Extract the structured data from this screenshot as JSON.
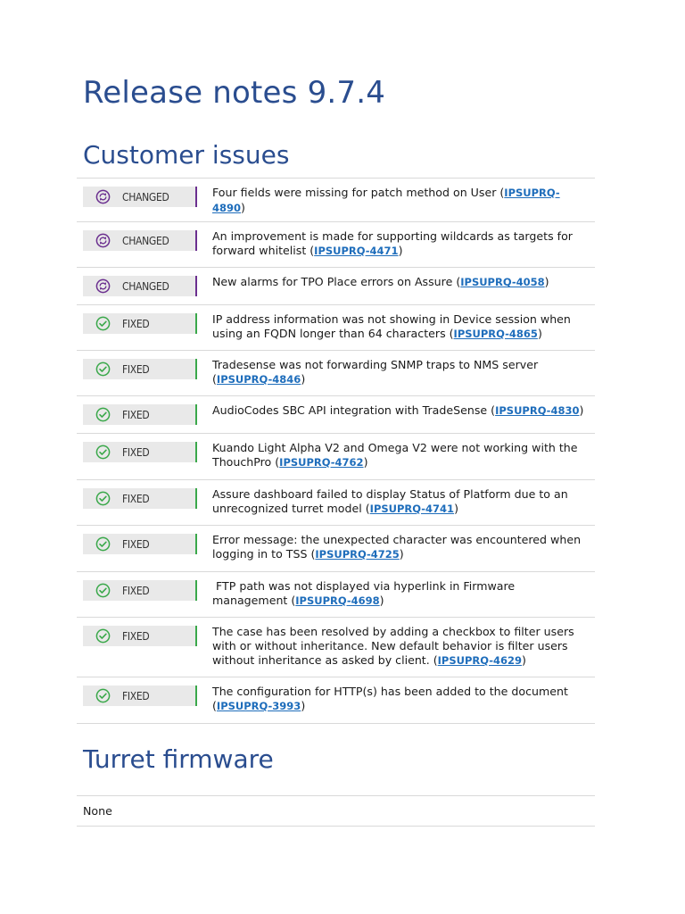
{
  "title": "Release notes 9.7.4",
  "sections": {
    "customer_issues": "Customer issues",
    "turret_firmware": "Turret firmware"
  },
  "colors": {
    "heading": "#2a4d8f",
    "changed": "#6b2f8f",
    "fixed": "#3aa84a",
    "link": "#1e6dbb"
  },
  "issues": [
    {
      "type": "changed",
      "label": "CHANGED",
      "icon": "changed-cycle-icon",
      "text": "Four fields were missing for patch method on User (",
      "ticket": "IPSUPRQ-4890",
      "suffix": ")"
    },
    {
      "type": "changed",
      "label": "CHANGED",
      "icon": "changed-cycle-icon",
      "text": "An improvement is made for supporting wildcards as targets for forward whitelist (",
      "ticket": "IPSUPRQ-4471",
      "suffix": ")"
    },
    {
      "type": "changed",
      "label": "CHANGED",
      "icon": "changed-cycle-icon",
      "text": "New alarms for TPO Place errors on Assure (",
      "ticket": "IPSUPRQ-4058",
      "suffix": ")"
    },
    {
      "type": "fixed",
      "label": "FIXED",
      "icon": "check-circle-icon",
      "text": "IP address information was not showing in Device session when using an FQDN longer than 64 characters (",
      "ticket": "IPSUPRQ-4865",
      "suffix": ")"
    },
    {
      "type": "fixed",
      "label": "FIXED",
      "icon": "check-circle-icon",
      "text": "Tradesense was not forwarding SNMP traps to NMS server (",
      "ticket": "IPSUPRQ-4846",
      "suffix": ")"
    },
    {
      "type": "fixed",
      "label": "FIXED",
      "icon": "check-circle-icon",
      "text": "AudioCodes SBC API integration with TradeSense (",
      "ticket": "IPSUPRQ-4830",
      "suffix": ")"
    },
    {
      "type": "fixed",
      "label": "FIXED",
      "icon": "check-circle-icon",
      "text": "Kuando Light Alpha V2 and Omega V2 were not working with the ThouchPro (",
      "ticket": "IPSUPRQ-4762",
      "suffix": ")"
    },
    {
      "type": "fixed",
      "label": "FIXED",
      "icon": "check-circle-icon",
      "text": "Assure dashboard failed to display Status of Platform due to an unrecognized turret model (",
      "ticket": "IPSUPRQ-4741",
      "suffix": ")"
    },
    {
      "type": "fixed",
      "label": "FIXED",
      "icon": "check-circle-icon",
      "text": "Error message: the unexpected character was encountered when logging in to TSS (",
      "ticket": "IPSUPRQ-4725",
      "suffix": ")"
    },
    {
      "type": "fixed",
      "label": "FIXED",
      "icon": "check-circle-icon",
      "text": " FTP path was not displayed via hyperlink in Firmware management (",
      "ticket": "IPSUPRQ-4698",
      "suffix": ")"
    },
    {
      "type": "fixed",
      "label": "FIXED",
      "icon": "check-circle-icon",
      "text": "The case has been resolved by adding a checkbox to filter users with or without inheritance. New default behavior is filter users without inheritance as asked by client. (",
      "ticket": "IPSUPRQ-4629",
      "suffix": ")"
    },
    {
      "type": "fixed",
      "label": "FIXED",
      "icon": "check-circle-icon",
      "text": "The configuration for HTTP(s) has been added to the document (",
      "ticket": "IPSUPRQ-3993",
      "suffix": ")"
    }
  ],
  "firmware_note": "None"
}
